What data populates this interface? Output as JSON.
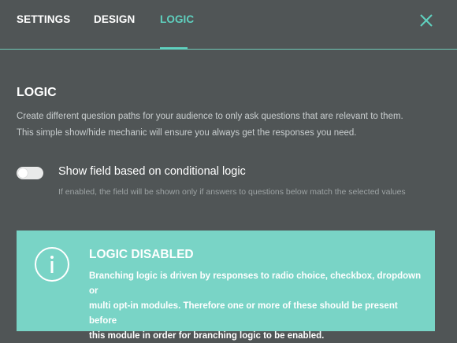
{
  "tabs": [
    {
      "label": "SETTINGS"
    },
    {
      "label": "DESIGN"
    },
    {
      "label": "LOGIC"
    }
  ],
  "active_tab": "LOGIC",
  "close_icon": "close-icon",
  "logic": {
    "title": "LOGIC",
    "description_line1": "Create different question paths for your audience to only ask questions that are relevant to them.",
    "description_line2": "This simple show/hide mechanic will ensure you always get the responses you need.",
    "toggle": {
      "label": "Show field based on conditional logic",
      "help": "If enabled, the field will be shown only if answers to questions below match the selected values",
      "enabled": false
    },
    "notice": {
      "icon": "info-icon",
      "title": "LOGIC DISABLED",
      "line1": "Branching logic is driven by responses to radio choice, checkbox, dropdown or",
      "line2": "multi opt-in modules. Therefore one or more of these should be present before",
      "line3": "this module in order for branching logic to be enabled."
    }
  },
  "colors": {
    "background": "#505556",
    "accent": "#5fd1bf",
    "notice_bg": "#79d4c6"
  }
}
